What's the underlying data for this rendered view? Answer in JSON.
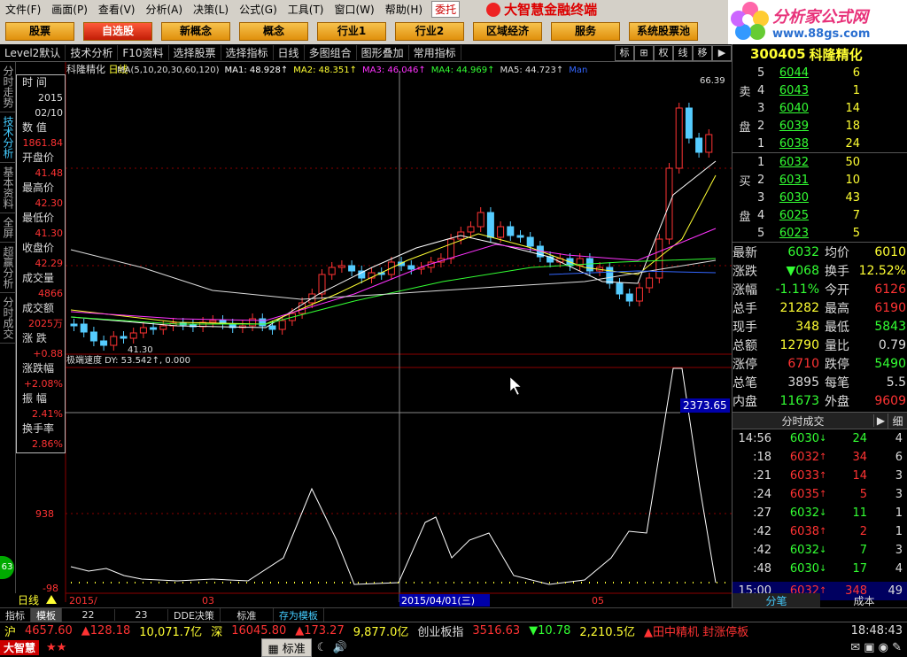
{
  "menu": {
    "items": [
      "文件(F)",
      "画面(P)",
      "查看(V)",
      "分析(A)",
      "决策(L)",
      "公式(G)",
      "工具(T)",
      "窗口(W)",
      "帮助(H)"
    ],
    "entrust": "委托",
    "brand": "大智慧金融终端"
  },
  "logo": {
    "title": "分析家公式网",
    "url": "www.88gs.com"
  },
  "nav": {
    "buttons": [
      "股票",
      "自选股",
      "新概念",
      "概念",
      "行业1",
      "行业2",
      "区域经济",
      "服务",
      "系统股票池"
    ],
    "active_index": 1
  },
  "toolbar": {
    "items": [
      "Level2默认",
      "技术分析",
      "F10资料",
      "选择股票",
      "选择指标",
      "日线",
      "多图组合",
      "图形叠加",
      "常用指标"
    ],
    "right_icons": [
      "标",
      "⊞",
      "权",
      "线",
      "移",
      "▶"
    ]
  },
  "left_tabs": [
    "分时走势",
    "技术分析",
    "基本资料",
    "全屏",
    "超赢分析",
    "分时成交"
  ],
  "left_badge": "63",
  "chart": {
    "title": "科隆精化",
    "period": "日线",
    "ma_legend": [
      {
        "label": "MA(5,10,20,30,60,120)",
        "color": "#dddddd"
      },
      {
        "label": "MA1: 48.928↑",
        "color": "#ffffff"
      },
      {
        "label": "MA2: 48.351↑",
        "color": "#ffff33"
      },
      {
        "label": "MA3: 46.046↑",
        "color": "#ff33ff"
      },
      {
        "label": "MA4: 44.969↑",
        "color": "#33ff33"
      },
      {
        "label": "MA5: 44.723↑",
        "color": "#dddddd"
      },
      {
        "label": "Man",
        "color": "#3366ff"
      }
    ],
    "indicator_legend": "极端速度 DY: 53.542↑, 0.000",
    "price_high_label": "66.39",
    "price_low_label": "41.30",
    "axis_left_labels": [
      "938",
      "-98"
    ],
    "cursor_value": "2373.65",
    "date_labels": [
      "2015/",
      "03",
      "2015/04/01(三)",
      "05"
    ],
    "period_tag": "日线"
  },
  "infobox": {
    "items": [
      {
        "label": "时 间",
        "values": [
          "2015",
          "02/10"
        ]
      },
      {
        "label": "数 值",
        "values": [
          "1861.84"
        ]
      },
      {
        "label": "开盘价",
        "values": [
          "41.48"
        ]
      },
      {
        "label": "最高价",
        "values": [
          "42.30"
        ]
      },
      {
        "label": "最低价",
        "values": [
          "41.30"
        ]
      },
      {
        "label": "收盘价",
        "values": [
          "42.29"
        ]
      },
      {
        "label": "成交量",
        "values": [
          "4866"
        ]
      },
      {
        "label": "成交额",
        "values": [
          "2025万"
        ]
      },
      {
        "label": "涨 跌",
        "values": [
          "+0.88"
        ]
      },
      {
        "label": "涨跌幅",
        "values": [
          "+2.08%"
        ]
      },
      {
        "label": "振 幅",
        "values": [
          "2.41%"
        ]
      },
      {
        "label": "换手率",
        "values": [
          "2.86%"
        ]
      }
    ]
  },
  "quote": {
    "code": "300405",
    "name": "科隆精化",
    "sell_label": [
      "卖",
      "盘"
    ],
    "buy_label": [
      "买",
      "盘"
    ],
    "sell": [
      {
        "lvl": "5",
        "price": "6044",
        "qty": "6"
      },
      {
        "lvl": "4",
        "price": "6043",
        "qty": "1"
      },
      {
        "lvl": "3",
        "price": "6040",
        "qty": "14"
      },
      {
        "lvl": "2",
        "price": "6039",
        "qty": "18"
      },
      {
        "lvl": "1",
        "price": "6038",
        "qty": "24"
      }
    ],
    "buy": [
      {
        "lvl": "1",
        "price": "6032",
        "qty": "50"
      },
      {
        "lvl": "2",
        "price": "6031",
        "qty": "10"
      },
      {
        "lvl": "3",
        "price": "6030",
        "qty": "43"
      },
      {
        "lvl": "4",
        "price": "6025",
        "qty": "7"
      },
      {
        "lvl": "5",
        "price": "6023",
        "qty": "5"
      }
    ],
    "rows": [
      {
        "l1": "最新",
        "v1": "6032",
        "c1": "green",
        "l2": "均价",
        "v2": "6010",
        "c2": "yellow"
      },
      {
        "l1": "涨跌",
        "v1": "▼068",
        "c1": "green",
        "l2": "换手",
        "v2": "12.52%",
        "c2": "yellow"
      },
      {
        "l1": "涨幅",
        "v1": "-1.11%",
        "c1": "green",
        "l2": "今开",
        "v2": "6126",
        "c2": "red"
      },
      {
        "l1": "总手",
        "v1": "21282",
        "c1": "yellow",
        "l2": "最高",
        "v2": "6190",
        "c2": "red"
      },
      {
        "l1": "现手",
        "v1": "348",
        "c1": "yellow",
        "l2": "最低",
        "v2": "5843",
        "c2": "green"
      },
      {
        "l1": "总额",
        "v1": "12790",
        "c1": "yellow",
        "l2": "量比",
        "v2": "0.79",
        "c2": "white"
      },
      {
        "l1": "涨停",
        "v1": "6710",
        "c1": "red",
        "l2": "跌停",
        "v2": "5490",
        "c2": "green"
      },
      {
        "l1": "总笔",
        "v1": "3895",
        "c1": "white",
        "l2": "每笔",
        "v2": "5.5",
        "c2": "white"
      },
      {
        "l1": "内盘",
        "v1": "11673",
        "c1": "green",
        "l2": "外盘",
        "v2": "9609",
        "c2": "red"
      }
    ],
    "ticks_title": "分时成交",
    "ticks_detail": "细",
    "ticks": [
      {
        "time": "14:56",
        "price": "6030",
        "dir": "down",
        "vol": "24",
        "cnt": "4"
      },
      {
        "time": ":18",
        "price": "6032",
        "dir": "up",
        "vol": "34",
        "cnt": "6"
      },
      {
        "time": ":21",
        "price": "6033",
        "dir": "up",
        "vol": "14",
        "cnt": "3"
      },
      {
        "time": ":24",
        "price": "6035",
        "dir": "up",
        "vol": "5",
        "cnt": "3"
      },
      {
        "time": ":27",
        "price": "6032",
        "dir": "down",
        "vol": "11",
        "cnt": "1"
      },
      {
        "time": ":42",
        "price": "6038",
        "dir": "up",
        "vol": "2",
        "cnt": "1"
      },
      {
        "time": ":42",
        "price": "6032",
        "dir": "down",
        "vol": "7",
        "cnt": "3"
      },
      {
        "time": ":48",
        "price": "6030",
        "dir": "down",
        "vol": "17",
        "cnt": "4"
      },
      {
        "time": "15:00",
        "price": "6032",
        "dir": "up",
        "vol": "348",
        "cnt": "49"
      }
    ],
    "bottom_tabs": [
      "分笔",
      "成本"
    ]
  },
  "bottom": {
    "items": [
      "指标",
      "模板",
      "22",
      "23",
      "DDE决策",
      "标准",
      "存为模板"
    ],
    "active_index": 1
  },
  "status": {
    "row1": [
      {
        "text": "沪",
        "color": "#ff3"
      },
      {
        "text": "4657.60",
        "color": "#f33"
      },
      {
        "text": "▲128.18",
        "color": "#f33"
      },
      {
        "text": "10,071.7亿",
        "color": "#ff3"
      },
      {
        "text": "深",
        "color": "#ff3"
      },
      {
        "text": "16045.80",
        "color": "#f33"
      },
      {
        "text": "▲173.27",
        "color": "#f33"
      },
      {
        "text": "9,877.0亿",
        "color": "#ff3"
      },
      {
        "text": "创业板指",
        "color": "#ddd"
      },
      {
        "text": "3516.63",
        "color": "#f33"
      },
      {
        "text": "▼10.78",
        "color": "#3f3"
      },
      {
        "text": "2,210.5亿",
        "color": "#ff3"
      },
      {
        "text": "▲田中精机 封涨停板",
        "color": "#f33"
      },
      {
        "text": "18:48:43",
        "color": "#ddd"
      }
    ],
    "logo": "大智慧",
    "mode": "标准"
  }
}
